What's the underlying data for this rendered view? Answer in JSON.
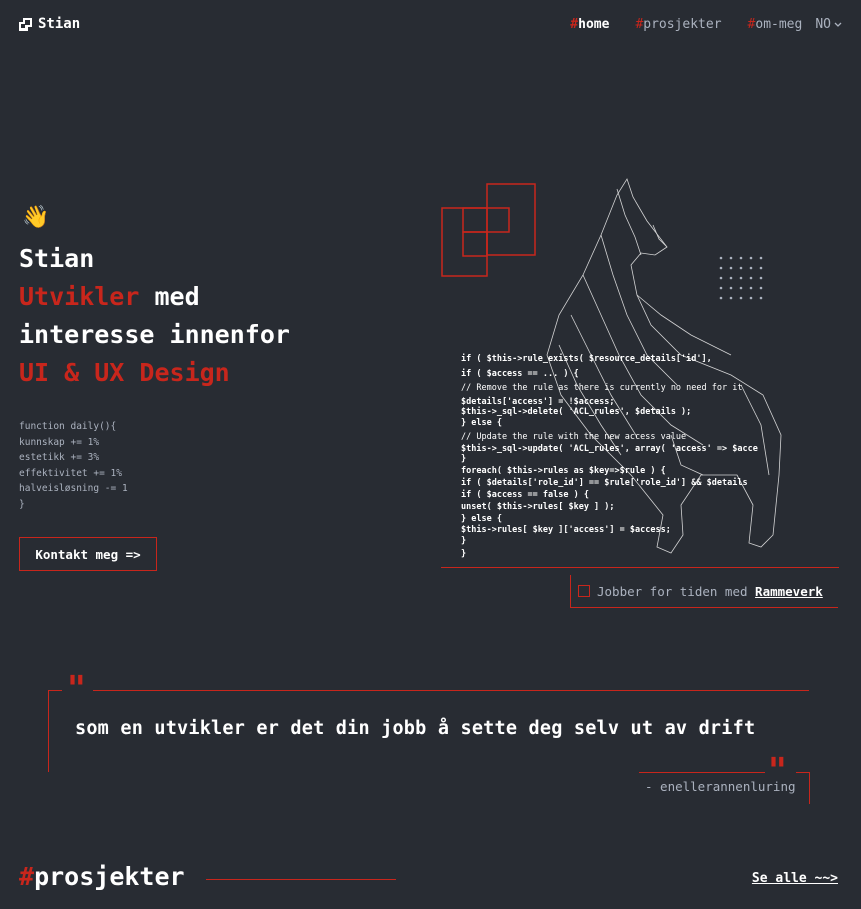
{
  "header": {
    "logo_text": "Stian",
    "nav": [
      {
        "hash": "#",
        "label": "home"
      },
      {
        "hash": "#",
        "label": "prosjekter"
      },
      {
        "hash": "#",
        "label": "om-meg"
      }
    ],
    "lang": "NO"
  },
  "hero": {
    "wave_emoji": "👋",
    "name": "Stian",
    "role_highlight": "Utvikler",
    "role_rest": " med",
    "line3": "interesse innenfor",
    "line4": "UI & UX Design",
    "code_lines": [
      "function daily(){",
      "kunnskap += 1%",
      "estetikk += 3%",
      "effektivitet += 1%",
      "halveisløsning -= 1",
      "}"
    ],
    "contact_button": "Kontakt meg =>",
    "status_text": "Jobber for tiden med ",
    "status_link": "Rammeverk",
    "image_code_lines": [
      "if ( $this->rule_exists( $resource_details['id'],",
      "    if ( $access == ... ) {",
      "        // Remove the rule as there is currently no need for it",
      "        $details['access'] = !$access;",
      "        $this->_sql->delete( 'ACL_rules', $details );",
      "    } else {",
      "        // Update the rule with the new access value",
      "        $this->_sql->update( 'ACL_rules', array( 'access' => $acce",
      "    }",
      "    foreach( $this->rules as $key=>$rule ) {",
      "        if ( $details['role_id'] == $rule['role_id'] && $details",
      "            if ( $access == false ) {",
      "                unset( $this->rules[ $key ] );",
      "            } else {",
      "                $this->rules[ $key ]['access'] = $access;",
      "            }",
      "        }"
    ]
  },
  "quote": {
    "text": "som en utvikler er det din jobb å sette deg selv ut av drift",
    "author": "- enellerannenluring",
    "mark": "\""
  },
  "projects": {
    "hash": "#",
    "title": "prosjekter",
    "see_all": "Se alle ~~>"
  },
  "colors": {
    "background": "#282c33",
    "accent": "#c8261c",
    "text": "#ffffff",
    "muted": "#abb2bf"
  }
}
